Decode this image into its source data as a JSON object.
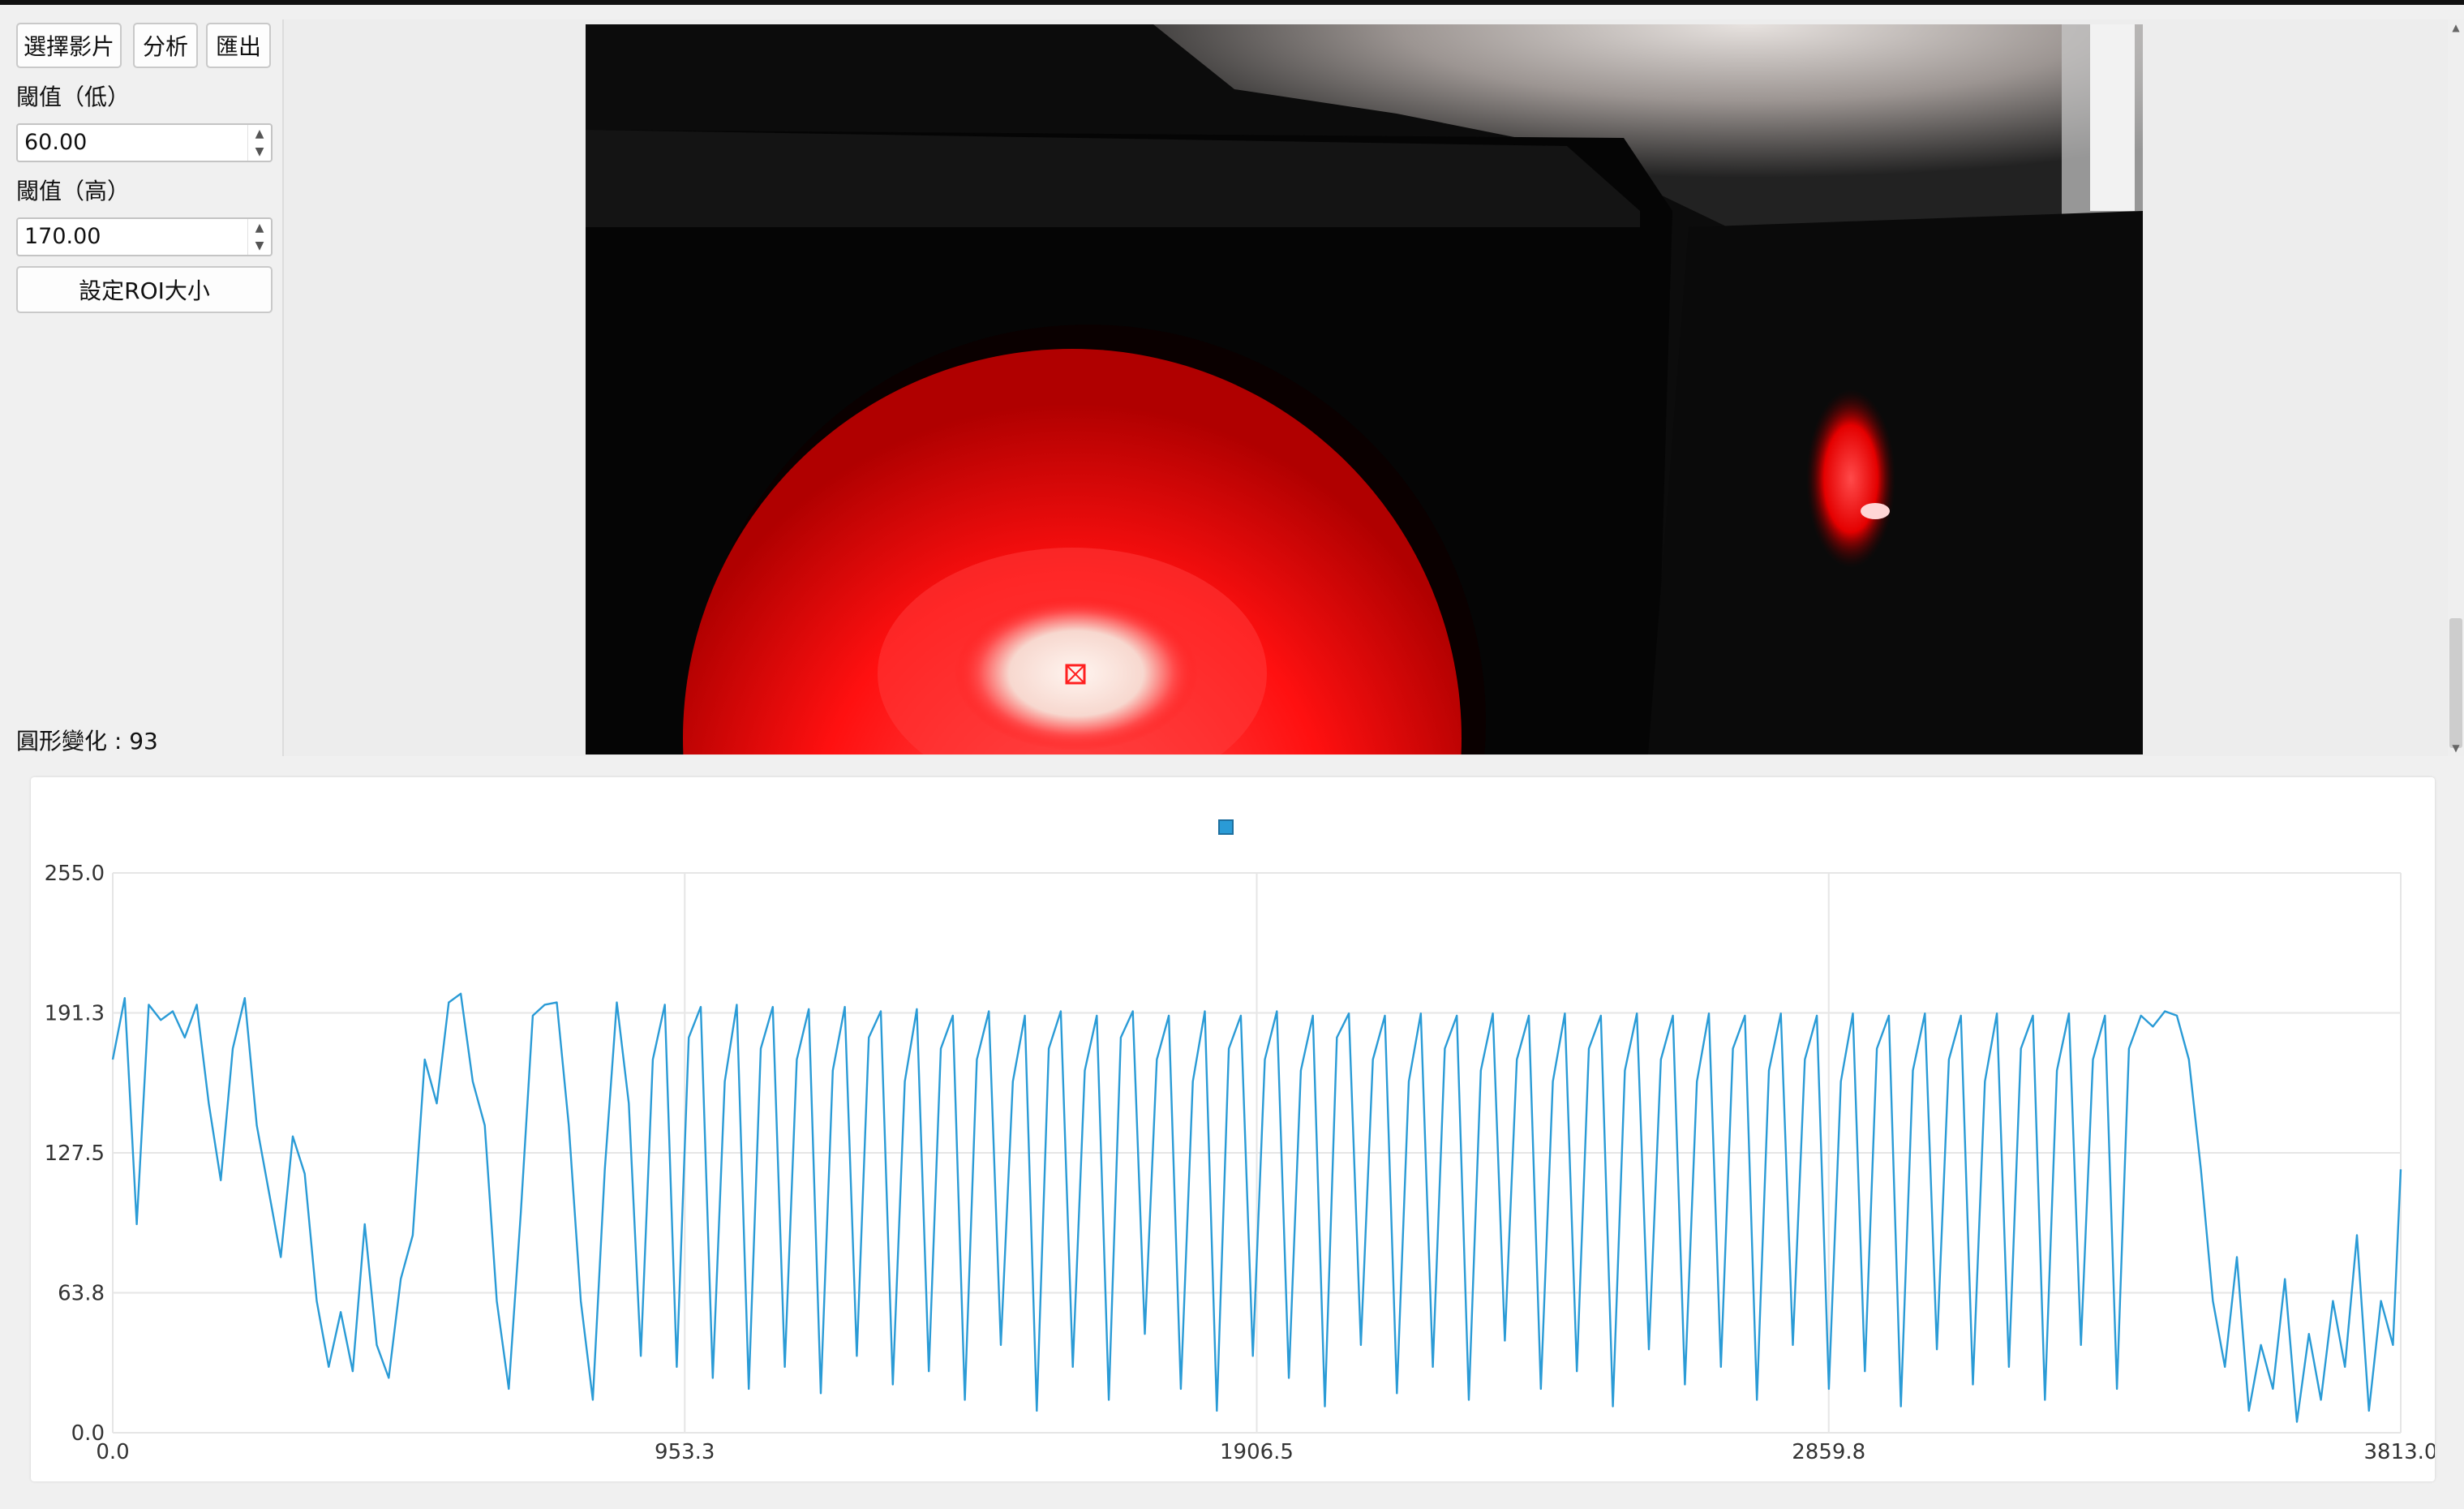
{
  "controls": {
    "select_video_label": "選擇影片",
    "analyze_label": "分析",
    "export_label": "匯出",
    "threshold_low_label": "閾值（低）",
    "threshold_low_value": "60.00",
    "threshold_high_label": "閾值（高）",
    "threshold_high_value": "170.00",
    "set_roi_label": "設定ROI大小",
    "circle_change_text": "圓形變化 : 93"
  },
  "colors": {
    "series": "#2a9bd6",
    "laser_red": "#ff1a1a",
    "panel_bg": "#f0f0f0"
  },
  "chart_data": {
    "type": "line",
    "title": "",
    "xlabel": "",
    "ylabel": "",
    "xlim": [
      0,
      3813.0
    ],
    "ylim": [
      0,
      255.0
    ],
    "x_ticks": [
      "0.0",
      "953.3",
      "1906.5",
      "2859.8",
      "3813.0"
    ],
    "y_ticks": [
      "0.0",
      "63.8",
      "127.5",
      "191.3",
      "255.0"
    ],
    "grid": true,
    "legend": "top-center",
    "series": [
      {
        "points": [
          [
            0,
            170
          ],
          [
            20,
            198
          ],
          [
            40,
            95
          ],
          [
            60,
            195
          ],
          [
            80,
            188
          ],
          [
            100,
            192
          ],
          [
            120,
            180
          ],
          [
            140,
            195
          ],
          [
            160,
            150
          ],
          [
            180,
            115
          ],
          [
            200,
            175
          ],
          [
            220,
            198
          ],
          [
            240,
            140
          ],
          [
            260,
            110
          ],
          [
            280,
            80
          ],
          [
            300,
            135
          ],
          [
            320,
            118
          ],
          [
            340,
            60
          ],
          [
            360,
            30
          ],
          [
            380,
            55
          ],
          [
            400,
            28
          ],
          [
            420,
            95
          ],
          [
            440,
            40
          ],
          [
            460,
            25
          ],
          [
            480,
            70
          ],
          [
            500,
            90
          ],
          [
            520,
            170
          ],
          [
            540,
            150
          ],
          [
            560,
            196
          ],
          [
            580,
            200
          ],
          [
            600,
            160
          ],
          [
            620,
            140
          ],
          [
            640,
            60
          ],
          [
            660,
            20
          ],
          [
            680,
            100
          ],
          [
            700,
            190
          ],
          [
            720,
            195
          ],
          [
            740,
            196
          ],
          [
            760,
            140
          ],
          [
            780,
            60
          ],
          [
            800,
            15
          ],
          [
            820,
            120
          ],
          [
            840,
            196
          ],
          [
            860,
            150
          ],
          [
            880,
            35
          ],
          [
            900,
            170
          ],
          [
            920,
            195
          ],
          [
            940,
            30
          ],
          [
            960,
            180
          ],
          [
            980,
            194
          ],
          [
            1000,
            25
          ],
          [
            1020,
            160
          ],
          [
            1040,
            195
          ],
          [
            1060,
            20
          ],
          [
            1080,
            175
          ],
          [
            1100,
            194
          ],
          [
            1120,
            30
          ],
          [
            1140,
            170
          ],
          [
            1160,
            193
          ],
          [
            1180,
            18
          ],
          [
            1200,
            165
          ],
          [
            1220,
            194
          ],
          [
            1240,
            35
          ],
          [
            1260,
            180
          ],
          [
            1280,
            192
          ],
          [
            1300,
            22
          ],
          [
            1320,
            160
          ],
          [
            1340,
            193
          ],
          [
            1360,
            28
          ],
          [
            1380,
            175
          ],
          [
            1400,
            190
          ],
          [
            1420,
            15
          ],
          [
            1440,
            170
          ],
          [
            1460,
            192
          ],
          [
            1480,
            40
          ],
          [
            1500,
            160
          ],
          [
            1520,
            190
          ],
          [
            1540,
            10
          ],
          [
            1560,
            175
          ],
          [
            1580,
            192
          ],
          [
            1600,
            30
          ],
          [
            1620,
            165
          ],
          [
            1640,
            190
          ],
          [
            1660,
            15
          ],
          [
            1680,
            180
          ],
          [
            1700,
            192
          ],
          [
            1720,
            45
          ],
          [
            1740,
            170
          ],
          [
            1760,
            190
          ],
          [
            1780,
            20
          ],
          [
            1800,
            160
          ],
          [
            1820,
            192
          ],
          [
            1840,
            10
          ],
          [
            1860,
            175
          ],
          [
            1880,
            190
          ],
          [
            1900,
            35
          ],
          [
            1920,
            170
          ],
          [
            1940,
            192
          ],
          [
            1960,
            25
          ],
          [
            1980,
            165
          ],
          [
            2000,
            190
          ],
          [
            2020,
            12
          ],
          [
            2040,
            180
          ],
          [
            2060,
            191
          ],
          [
            2080,
            40
          ],
          [
            2100,
            170
          ],
          [
            2120,
            190
          ],
          [
            2140,
            18
          ],
          [
            2160,
            160
          ],
          [
            2180,
            191
          ],
          [
            2200,
            30
          ],
          [
            2220,
            175
          ],
          [
            2240,
            190
          ],
          [
            2260,
            15
          ],
          [
            2280,
            165
          ],
          [
            2300,
            191
          ],
          [
            2320,
            42
          ],
          [
            2340,
            170
          ],
          [
            2360,
            190
          ],
          [
            2380,
            20
          ],
          [
            2400,
            160
          ],
          [
            2420,
            191
          ],
          [
            2440,
            28
          ],
          [
            2460,
            175
          ],
          [
            2480,
            190
          ],
          [
            2500,
            12
          ],
          [
            2520,
            165
          ],
          [
            2540,
            191
          ],
          [
            2560,
            38
          ],
          [
            2580,
            170
          ],
          [
            2600,
            190
          ],
          [
            2620,
            22
          ],
          [
            2640,
            160
          ],
          [
            2660,
            191
          ],
          [
            2680,
            30
          ],
          [
            2700,
            175
          ],
          [
            2720,
            190
          ],
          [
            2740,
            15
          ],
          [
            2760,
            165
          ],
          [
            2780,
            191
          ],
          [
            2800,
            40
          ],
          [
            2820,
            170
          ],
          [
            2840,
            190
          ],
          [
            2860,
            20
          ],
          [
            2880,
            160
          ],
          [
            2900,
            191
          ],
          [
            2920,
            28
          ],
          [
            2940,
            175
          ],
          [
            2960,
            190
          ],
          [
            2980,
            12
          ],
          [
            3000,
            165
          ],
          [
            3020,
            191
          ],
          [
            3040,
            38
          ],
          [
            3060,
            170
          ],
          [
            3080,
            190
          ],
          [
            3100,
            22
          ],
          [
            3120,
            160
          ],
          [
            3140,
            191
          ],
          [
            3160,
            30
          ],
          [
            3180,
            175
          ],
          [
            3200,
            190
          ],
          [
            3220,
            15
          ],
          [
            3240,
            165
          ],
          [
            3260,
            191
          ],
          [
            3280,
            40
          ],
          [
            3300,
            170
          ],
          [
            3320,
            190
          ],
          [
            3340,
            20
          ],
          [
            3360,
            175
          ],
          [
            3380,
            190
          ],
          [
            3400,
            185
          ],
          [
            3420,
            192
          ],
          [
            3440,
            190
          ],
          [
            3460,
            170
          ],
          [
            3480,
            120
          ],
          [
            3500,
            60
          ],
          [
            3520,
            30
          ],
          [
            3540,
            80
          ],
          [
            3560,
            10
          ],
          [
            3580,
            40
          ],
          [
            3600,
            20
          ],
          [
            3620,
            70
          ],
          [
            3640,
            5
          ],
          [
            3660,
            45
          ],
          [
            3680,
            15
          ],
          [
            3700,
            60
          ],
          [
            3720,
            30
          ],
          [
            3740,
            90
          ],
          [
            3760,
            10
          ],
          [
            3780,
            60
          ],
          [
            3800,
            40
          ],
          [
            3813,
            120
          ]
        ]
      }
    ]
  }
}
